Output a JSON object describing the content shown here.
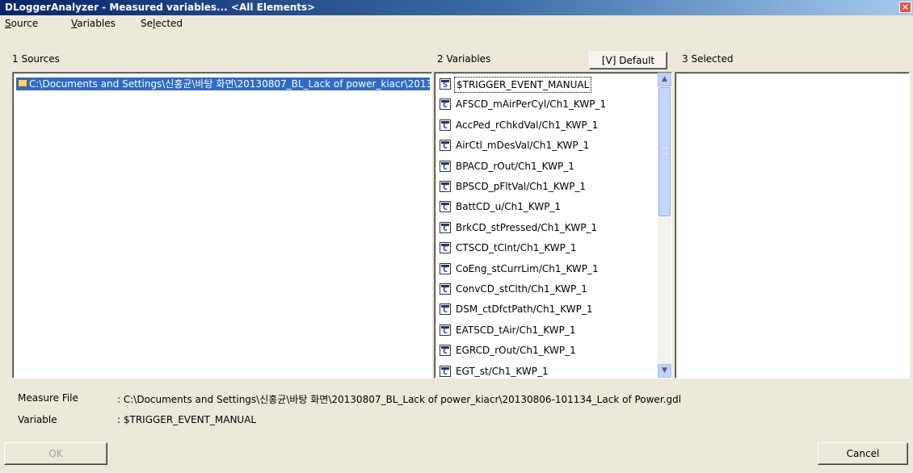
{
  "window": {
    "title": "DLoggerAnalyzer - Measured variables... <All Elements>",
    "close_glyph": "×"
  },
  "menu": [
    {
      "label": "Source",
      "mnemonic": "S",
      "rest": "ource"
    },
    {
      "label": "Variables",
      "mnemonic": "V",
      "rest": "ariables"
    },
    {
      "label": "Selected",
      "pre": "Se",
      "mnemonic": "l",
      "rest": "ected"
    }
  ],
  "panels": {
    "sources_header": "1 Sources",
    "variables_header": "2 Variables",
    "selected_header": "3 Selected",
    "default_button": "[V] Default"
  },
  "sources": [
    {
      "label": "C:\\Documents and Settings\\신홍균\\바탕 화면\\20130807_BL_Lack of power_kiacr\\20130806-101134_Lack of Power.gdl",
      "icon": "folder-icon"
    }
  ],
  "variables": [
    {
      "name": "$TRIGGER_EVENT_MANUAL",
      "icon": "S"
    },
    {
      "name": "AFSCD_mAirPerCyl/Ch1_KWP_1",
      "icon": "C"
    },
    {
      "name": "AccPed_rChkdVal/Ch1_KWP_1",
      "icon": "C"
    },
    {
      "name": "AirCtl_mDesVal/Ch1_KWP_1",
      "icon": "C"
    },
    {
      "name": "BPACD_rOut/Ch1_KWP_1",
      "icon": "C"
    },
    {
      "name": "BPSCD_pFltVal/Ch1_KWP_1",
      "icon": "C"
    },
    {
      "name": "BattCD_u/Ch1_KWP_1",
      "icon": "C"
    },
    {
      "name": "BrkCD_stPressed/Ch1_KWP_1",
      "icon": "C"
    },
    {
      "name": "CTSCD_tClnt/Ch1_KWP_1",
      "icon": "C"
    },
    {
      "name": "CoEng_stCurrLim/Ch1_KWP_1",
      "icon": "C"
    },
    {
      "name": "ConvCD_stClth/Ch1_KWP_1",
      "icon": "C"
    },
    {
      "name": "DSM_ctDfctPath/Ch1_KWP_1",
      "icon": "C"
    },
    {
      "name": "EATSCD_tAir/Ch1_KWP_1",
      "icon": "C"
    },
    {
      "name": "EGRCD_rOut/Ch1_KWP_1",
      "icon": "C"
    },
    {
      "name": "EGT_st/Ch1_KWP_1",
      "icon": "C"
    }
  ],
  "info": {
    "measure_file_label": "Measure File",
    "measure_file_value": ": C:\\Documents and Settings\\신홍균\\바탕 화면\\20130807_BL_Lack of power_kiacr\\20130806-101134_Lack of Power.gdl",
    "variable_label": "Variable",
    "variable_value": ": $TRIGGER_EVENT_MANUAL"
  },
  "buttons": {
    "ok": "OK",
    "cancel": "Cancel"
  },
  "colors": {
    "selection": "#316ac5",
    "title_start": "#0a246a"
  }
}
